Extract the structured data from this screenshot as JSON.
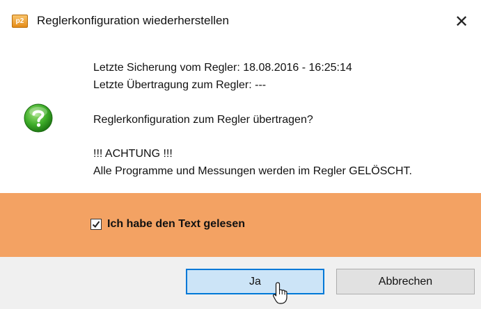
{
  "window": {
    "title": "Reglerkonfiguration wiederherstellen",
    "app_icon_text": "p2",
    "close_glyph": "✕"
  },
  "message": {
    "line1": "Letzte Sicherung vom Regler: 18.08.2016 - 16:25:14",
    "line2": "Letzte Übertragung zum Regler:  ---",
    "question": "Reglerkonfiguration zum Regler übertragen?",
    "warning_heading": "!!! ACHTUNG !!!",
    "warning_text": "Alle Programme und Messungen werden im Regler GELÖSCHT."
  },
  "confirm": {
    "checkbox_label": "Ich habe den Text gelesen",
    "checked": true
  },
  "buttons": {
    "yes": "Ja",
    "cancel": "Abbrechen"
  },
  "icons": {
    "app": "p2-app-icon",
    "question": "question-icon",
    "close": "close-icon",
    "cursor": "mouse-cursor-icon"
  },
  "colors": {
    "warning_band": "#f3a263",
    "footer": "#f0f0f0",
    "default_button_bg": "#cce4f7",
    "default_button_border": "#0078d7",
    "question_icon": "#3fae2a"
  }
}
